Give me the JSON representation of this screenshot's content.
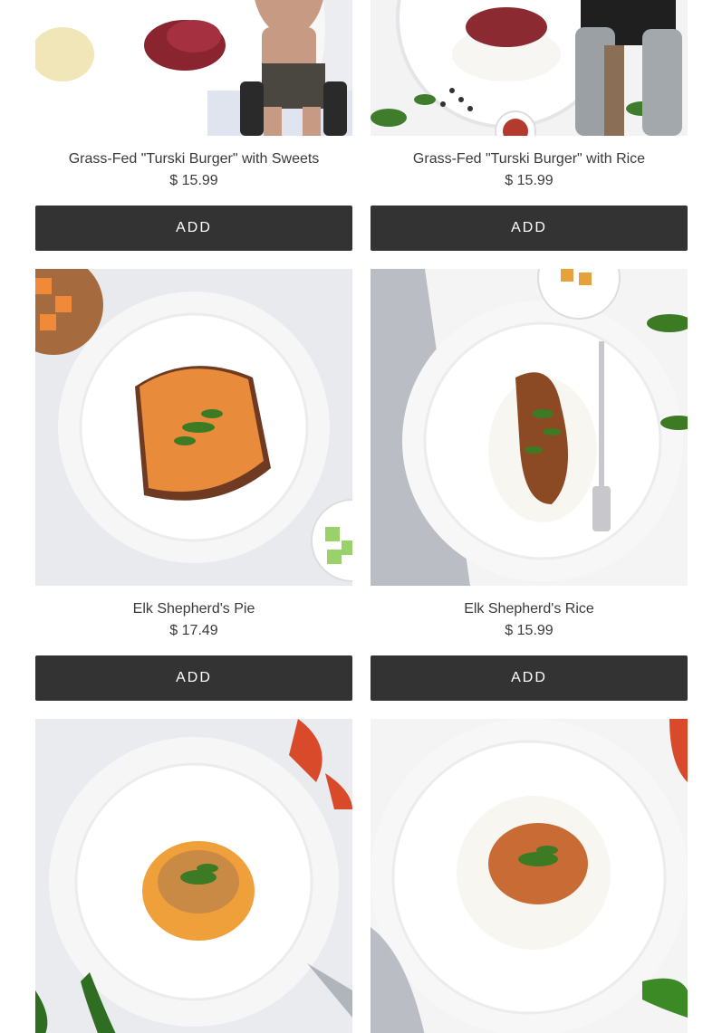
{
  "products": [
    {
      "title": "Grass-Fed \"Turski Burger\" with Sweets",
      "price": "$ 15.99",
      "button": "ADD",
      "image": "burger-sweets-plate-image"
    },
    {
      "title": "Grass-Fed \"Turski Burger\" with Rice",
      "price": "$ 15.99",
      "button": "ADD",
      "image": "burger-rice-plate-image"
    },
    {
      "title": "Elk Shepherd's Pie",
      "price": "$ 17.49",
      "button": "ADD",
      "image": "shepherds-pie-plate-image"
    },
    {
      "title": "Elk Shepherd's Rice",
      "price": "$ 15.99",
      "button": "ADD",
      "image": "shepherds-rice-plate-image"
    },
    {
      "title": "",
      "price": "",
      "button": "",
      "image": "chicken-sweet-potato-plate-image"
    },
    {
      "title": "",
      "price": "",
      "button": "",
      "image": "chicken-rice-plate-image"
    }
  ],
  "colors": {
    "button_bg": "#333333",
    "button_text": "#ffffff",
    "text": "#3a3a3a",
    "background": "#ffffff"
  }
}
